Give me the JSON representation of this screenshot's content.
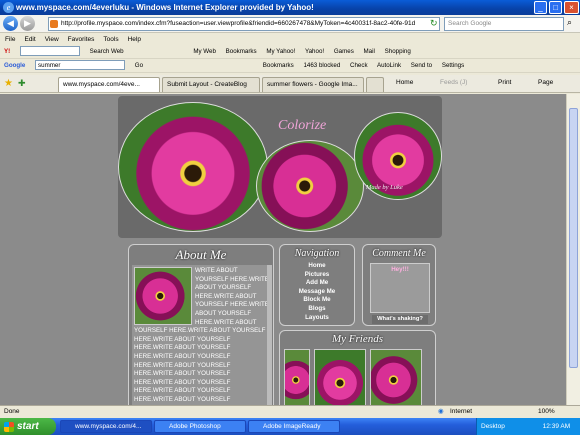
{
  "window": {
    "title": "www.myspace.com/4everluku - Windows Internet Explorer provided by Yahoo!"
  },
  "address": {
    "url": "http://profile.myspace.com/index.cfm?fuseaction=user.viewprofile&friendid=660267478&MyToken=4c40031f-8ac2-40fe-91d",
    "search_placeholder": "Search Google"
  },
  "menu": [
    "File",
    "Edit",
    "View",
    "Favorites",
    "Tools",
    "Help"
  ],
  "yahoo_toolbar": {
    "search_label": "Search Web",
    "items": [
      "My Web",
      "Bookmarks",
      "My Yahoo!",
      "Yahoo!",
      "Games",
      "Mail",
      "Shopping"
    ]
  },
  "google_toolbar": {
    "query": "summer",
    "go": "Go",
    "items": [
      "Bookmarks",
      "1463 blocked",
      "Check",
      "AutoLink",
      "Send to",
      "Settings"
    ]
  },
  "tabs": [
    "www.myspace.com/4eve...",
    "Submit Layout - CreateBlog",
    "summer flowers - Google Ima..."
  ],
  "tab_tools": [
    "Home",
    "Feeds (J)",
    "Print",
    "Page"
  ],
  "page": {
    "banner_text": "Colorize",
    "banner_credit": "Made by Luke",
    "about": {
      "heading": "About Me",
      "body": "WRITE ABOUT YOURSELF HERE.WRITE ABOUT YOURSELF HERE.WRITE ABOUT YOURSELF HERE.WRITE ABOUT YOURSELF HERE.WRITE ABOUT YOURSELF HERE.WRITE ABOUT YOURSELF HERE.WRITE ABOUT YOURSELF HERE.WRITE ABOUT YOURSELF HERE.WRITE ABOUT YOURSELF HERE.WRITE ABOUT YOURSELF HERE.WRITE ABOUT YOURSELF HERE.WRITE ABOUT YOURSELF HERE.WRITE ABOUT YOURSELF HERE.WRITE ABOUT YOURSELF HERE.WRITE ABOUT YOURSELF HERE.WRITE ABOUT"
    },
    "navigation": {
      "heading": "Navigation",
      "links": [
        "Home",
        "Pictures",
        "Add Me",
        "Message Me",
        "Block Me",
        "Blogs",
        "Layouts"
      ]
    },
    "comment": {
      "heading": "Comment Me",
      "prompt": "Hey!!!",
      "button": "What's shaking?"
    },
    "friends": {
      "heading": "My Friends"
    }
  },
  "status": {
    "left": "Done",
    "zone": "Internet",
    "zoom": "100%"
  },
  "taskbar": {
    "start": "start",
    "items": [
      "www.myspace.com/4...",
      "Adobe Photoshop",
      "Adobe ImageReady"
    ],
    "desktop": "Desktop",
    "clock": "12:39 AM"
  }
}
